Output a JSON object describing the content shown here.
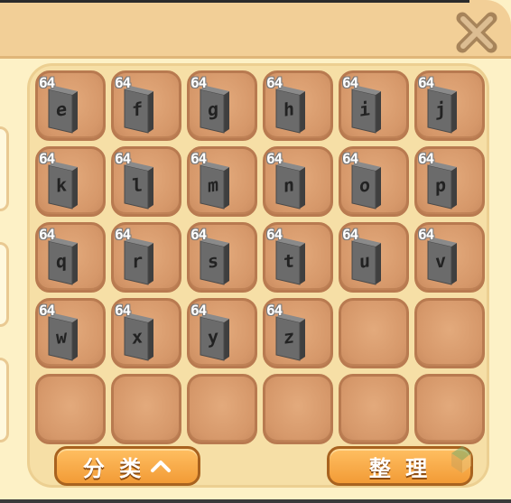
{
  "inventory": {
    "rows": 5,
    "cols": 6,
    "slots": [
      {
        "count": "64",
        "letter": "e"
      },
      {
        "count": "64",
        "letter": "f"
      },
      {
        "count": "64",
        "letter": "g"
      },
      {
        "count": "64",
        "letter": "h"
      },
      {
        "count": "64",
        "letter": "i"
      },
      {
        "count": "64",
        "letter": "j"
      },
      {
        "count": "64",
        "letter": "k"
      },
      {
        "count": "64",
        "letter": "l"
      },
      {
        "count": "64",
        "letter": "m"
      },
      {
        "count": "64",
        "letter": "n"
      },
      {
        "count": "64",
        "letter": "o"
      },
      {
        "count": "64",
        "letter": "p"
      },
      {
        "count": "64",
        "letter": "q"
      },
      {
        "count": "64",
        "letter": "r"
      },
      {
        "count": "64",
        "letter": "s"
      },
      {
        "count": "64",
        "letter": "t"
      },
      {
        "count": "64",
        "letter": "u"
      },
      {
        "count": "64",
        "letter": "v"
      },
      {
        "count": "64",
        "letter": "w"
      },
      {
        "count": "64",
        "letter": "x"
      },
      {
        "count": "64",
        "letter": "y"
      },
      {
        "count": "64",
        "letter": "z"
      },
      {},
      {},
      {},
      {},
      {},
      {},
      {},
      {}
    ]
  },
  "buttons": {
    "category_label": "分 类",
    "category_icon": "chevron-up-icon",
    "sort_label": "整 理"
  },
  "icons": {
    "close": "close-icon",
    "watermark": "watermark-logo"
  },
  "colors": {
    "header": "#f2cf97",
    "panel": "#fdf1c6",
    "slot": "#d6986a",
    "button": "#f29b36",
    "block": "#6b6b6b"
  }
}
